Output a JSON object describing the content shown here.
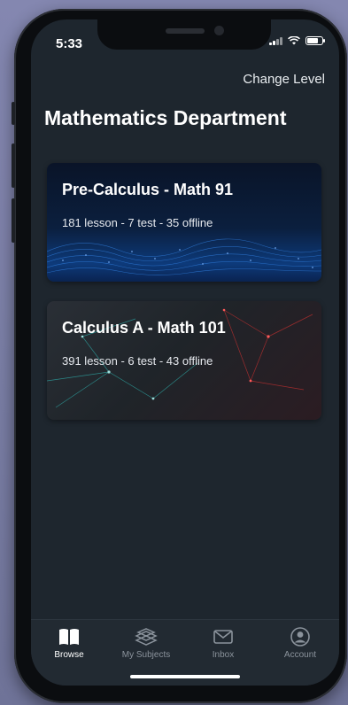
{
  "status_bar": {
    "time": "5:33"
  },
  "header": {
    "change_level": "Change Level",
    "title": "Mathematics Department"
  },
  "courses": [
    {
      "title": "Pre-Calculus - Math 91",
      "stats": "181 lesson - 7 test - 35 offline"
    },
    {
      "title": "Calculus A - Math 101",
      "stats": "391 lesson - 6 test - 43 offline"
    }
  ],
  "tabs": [
    {
      "label": "Browse",
      "icon": "book-icon",
      "active": true
    },
    {
      "label": "My Subjects",
      "icon": "stack-books-icon",
      "active": false
    },
    {
      "label": "Inbox",
      "icon": "envelope-icon",
      "active": false
    },
    {
      "label": "Account",
      "icon": "person-icon",
      "active": false
    }
  ],
  "colors": {
    "background": "#1e262e",
    "tabbar": "#222a32",
    "active_tab": "#ffffff",
    "inactive_tab": "#8b939c"
  }
}
